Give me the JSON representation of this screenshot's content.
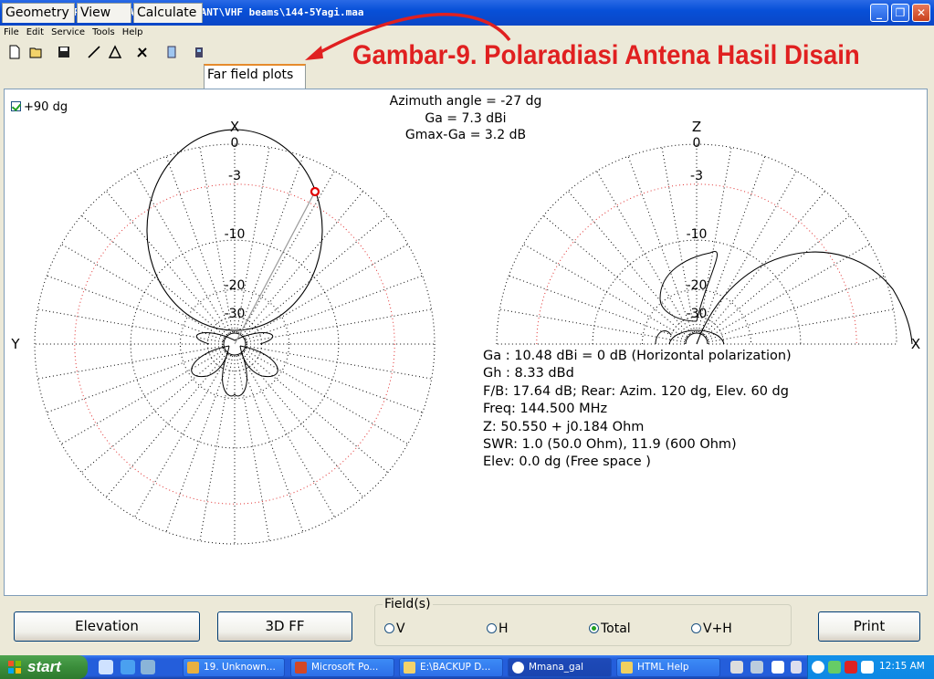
{
  "window": {
    "title": "D:\\SOFTWARE_ANTENNA\\MMANA-GAL\\ANT\\VHF beams\\144-5Yagi.maa",
    "minimize": "_",
    "maximize": "❐",
    "close": "✕"
  },
  "menu": [
    "File",
    "Edit",
    "Service",
    "Tools",
    "Help"
  ],
  "annotation": "Gambar-9. Polaradiasi Antena Hasil Disain",
  "tabs": [
    "Geometry",
    "View",
    "Calculate",
    "Far field plots"
  ],
  "active_tab": "Far field plots",
  "plot": {
    "checkbox_label": "+90 dg",
    "header": [
      "Azimuth angle = -27 dg",
      "Ga = 7.3 dBi",
      "Gmax-Ga = 3.2 dB"
    ],
    "left_axis_top": "X",
    "left_axis_side": "Y",
    "right_axis_top": "Z",
    "right_axis_side": "X",
    "ring_labels": [
      "0",
      "-3",
      "-10",
      "-20",
      "-30"
    ],
    "info": [
      "Ga : 10.48 dBi = 0 dB  (Horizontal polarization)",
      "Gh : 8.33 dBd",
      "F/B: 17.64 dB; Rear: Azim. 120 dg,  Elev. 60 dg",
      "Freq: 144.500 MHz",
      "Z: 50.550 + j0.184 Ohm",
      "SWR: 1.0 (50.0 Ohm), 11.9 (600 Ohm)",
      "Elev: 0.0 dg (Free space )"
    ]
  },
  "buttons": {
    "elevation": "Elevation",
    "ff3d": "3D FF",
    "print": "Print"
  },
  "fields": {
    "legend": "Field(s)",
    "options": [
      "V",
      "H",
      "Total",
      "V+H"
    ],
    "selected": "Total"
  },
  "taskbar": {
    "start": "start",
    "items": [
      "19. Unknown...",
      "Microsoft Po...",
      "E:\\BACKUP D...",
      "Mmana_gal",
      "HTML Help"
    ],
    "active": "Mmana_gal",
    "clock": "12:15 AM"
  },
  "colors": {
    "annotation": "#E02020",
    "tab_accent": "#E68B2C",
    "marker": "#E00000",
    "taskbar": "#245EDB"
  }
}
